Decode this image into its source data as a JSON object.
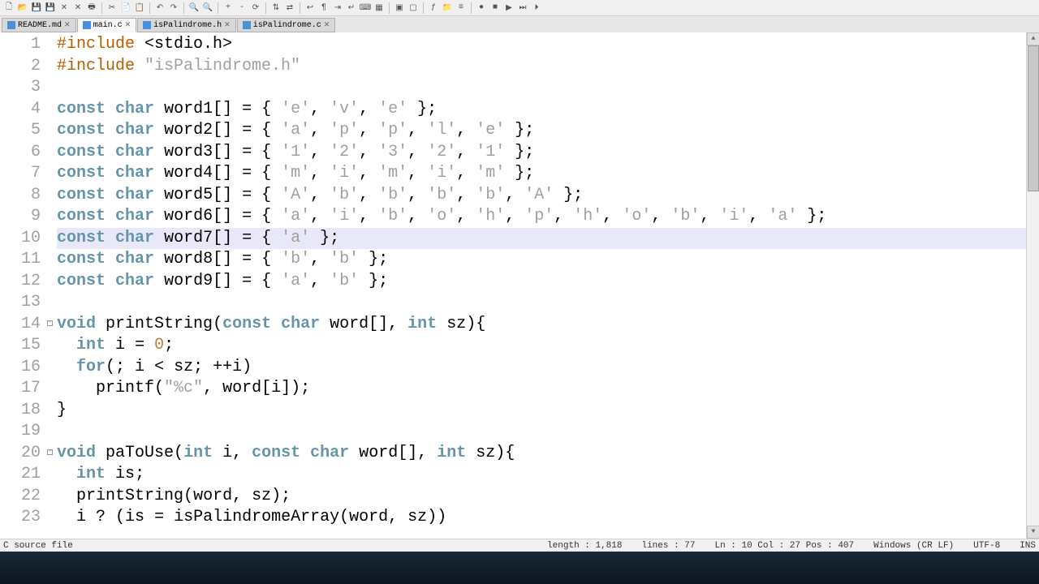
{
  "tabs": [
    {
      "label": "README.md",
      "active": false
    },
    {
      "label": "main.c",
      "active": true
    },
    {
      "label": "isPalindrome.h",
      "active": false
    },
    {
      "label": "isPalindrome.c",
      "active": false
    }
  ],
  "highlighted_line": 10,
  "code_lines": [
    {
      "n": 1,
      "tokens": [
        [
          "pp",
          "#include"
        ],
        [
          "op",
          " <"
        ],
        [
          "id",
          "stdio.h"
        ],
        [
          "op",
          ">"
        ]
      ]
    },
    {
      "n": 2,
      "tokens": [
        [
          "pp",
          "#include"
        ],
        [
          "op",
          " "
        ],
        [
          "str",
          "\"isPalindrome.h\""
        ]
      ]
    },
    {
      "n": 3,
      "tokens": []
    },
    {
      "n": 4,
      "tokens": [
        [
          "kw",
          "const"
        ],
        [
          "op",
          " "
        ],
        [
          "ty",
          "char"
        ],
        [
          "op",
          " "
        ],
        [
          "id",
          "word1"
        ],
        [
          "op",
          "[] = { "
        ],
        [
          "ch",
          "'e'"
        ],
        [
          "op",
          ", "
        ],
        [
          "ch",
          "'v'"
        ],
        [
          "op",
          ", "
        ],
        [
          "ch",
          "'e'"
        ],
        [
          "op",
          " };"
        ]
      ]
    },
    {
      "n": 5,
      "tokens": [
        [
          "kw",
          "const"
        ],
        [
          "op",
          " "
        ],
        [
          "ty",
          "char"
        ],
        [
          "op",
          " "
        ],
        [
          "id",
          "word2"
        ],
        [
          "op",
          "[] = { "
        ],
        [
          "ch",
          "'a'"
        ],
        [
          "op",
          ", "
        ],
        [
          "ch",
          "'p'"
        ],
        [
          "op",
          ", "
        ],
        [
          "ch",
          "'p'"
        ],
        [
          "op",
          ", "
        ],
        [
          "ch",
          "'l'"
        ],
        [
          "op",
          ", "
        ],
        [
          "ch",
          "'e'"
        ],
        [
          "op",
          " };"
        ]
      ]
    },
    {
      "n": 6,
      "tokens": [
        [
          "kw",
          "const"
        ],
        [
          "op",
          " "
        ],
        [
          "ty",
          "char"
        ],
        [
          "op",
          " "
        ],
        [
          "id",
          "word3"
        ],
        [
          "op",
          "[] = { "
        ],
        [
          "ch",
          "'1'"
        ],
        [
          "op",
          ", "
        ],
        [
          "ch",
          "'2'"
        ],
        [
          "op",
          ", "
        ],
        [
          "ch",
          "'3'"
        ],
        [
          "op",
          ", "
        ],
        [
          "ch",
          "'2'"
        ],
        [
          "op",
          ", "
        ],
        [
          "ch",
          "'1'"
        ],
        [
          "op",
          " };"
        ]
      ]
    },
    {
      "n": 7,
      "tokens": [
        [
          "kw",
          "const"
        ],
        [
          "op",
          " "
        ],
        [
          "ty",
          "char"
        ],
        [
          "op",
          " "
        ],
        [
          "id",
          "word4"
        ],
        [
          "op",
          "[] = { "
        ],
        [
          "ch",
          "'m'"
        ],
        [
          "op",
          ", "
        ],
        [
          "ch",
          "'i'"
        ],
        [
          "op",
          ", "
        ],
        [
          "ch",
          "'m'"
        ],
        [
          "op",
          ", "
        ],
        [
          "ch",
          "'i'"
        ],
        [
          "op",
          ", "
        ],
        [
          "ch",
          "'m'"
        ],
        [
          "op",
          " };"
        ]
      ]
    },
    {
      "n": 8,
      "tokens": [
        [
          "kw",
          "const"
        ],
        [
          "op",
          " "
        ],
        [
          "ty",
          "char"
        ],
        [
          "op",
          " "
        ],
        [
          "id",
          "word5"
        ],
        [
          "op",
          "[] = { "
        ],
        [
          "ch",
          "'A'"
        ],
        [
          "op",
          ", "
        ],
        [
          "ch",
          "'b'"
        ],
        [
          "op",
          ", "
        ],
        [
          "ch",
          "'b'"
        ],
        [
          "op",
          ", "
        ],
        [
          "ch",
          "'b'"
        ],
        [
          "op",
          ", "
        ],
        [
          "ch",
          "'b'"
        ],
        [
          "op",
          ", "
        ],
        [
          "ch",
          "'A'"
        ],
        [
          "op",
          " };"
        ]
      ]
    },
    {
      "n": 9,
      "tokens": [
        [
          "kw",
          "const"
        ],
        [
          "op",
          " "
        ],
        [
          "ty",
          "char"
        ],
        [
          "op",
          " "
        ],
        [
          "id",
          "word6"
        ],
        [
          "op",
          "[] = { "
        ],
        [
          "ch",
          "'a'"
        ],
        [
          "op",
          ", "
        ],
        [
          "ch",
          "'i'"
        ],
        [
          "op",
          ", "
        ],
        [
          "ch",
          "'b'"
        ],
        [
          "op",
          ", "
        ],
        [
          "ch",
          "'o'"
        ],
        [
          "op",
          ", "
        ],
        [
          "ch",
          "'h'"
        ],
        [
          "op",
          ", "
        ],
        [
          "ch",
          "'p'"
        ],
        [
          "op",
          ", "
        ],
        [
          "ch",
          "'h'"
        ],
        [
          "op",
          ", "
        ],
        [
          "ch",
          "'o'"
        ],
        [
          "op",
          ", "
        ],
        [
          "ch",
          "'b'"
        ],
        [
          "op",
          ", "
        ],
        [
          "ch",
          "'i'"
        ],
        [
          "op",
          ", "
        ],
        [
          "ch",
          "'a'"
        ],
        [
          "op",
          " };"
        ]
      ]
    },
    {
      "n": 10,
      "tokens": [
        [
          "kw",
          "const"
        ],
        [
          "op",
          " "
        ],
        [
          "ty",
          "char"
        ],
        [
          "op",
          " "
        ],
        [
          "id",
          "word7"
        ],
        [
          "op",
          "[] = { "
        ],
        [
          "ch",
          "'a'"
        ],
        [
          "op",
          " };"
        ]
      ]
    },
    {
      "n": 11,
      "tokens": [
        [
          "kw",
          "const"
        ],
        [
          "op",
          " "
        ],
        [
          "ty",
          "char"
        ],
        [
          "op",
          " "
        ],
        [
          "id",
          "word8"
        ],
        [
          "op",
          "[] = { "
        ],
        [
          "ch",
          "'b'"
        ],
        [
          "op",
          ", "
        ],
        [
          "ch",
          "'b'"
        ],
        [
          "op",
          " };"
        ]
      ]
    },
    {
      "n": 12,
      "tokens": [
        [
          "kw",
          "const"
        ],
        [
          "op",
          " "
        ],
        [
          "ty",
          "char"
        ],
        [
          "op",
          " "
        ],
        [
          "id",
          "word9"
        ],
        [
          "op",
          "[] = { "
        ],
        [
          "ch",
          "'a'"
        ],
        [
          "op",
          ", "
        ],
        [
          "ch",
          "'b'"
        ],
        [
          "op",
          " };"
        ]
      ]
    },
    {
      "n": 13,
      "tokens": []
    },
    {
      "n": 14,
      "tokens": [
        [
          "ty",
          "void"
        ],
        [
          "op",
          " "
        ],
        [
          "id",
          "printString"
        ],
        [
          "op",
          "("
        ],
        [
          "kw",
          "const"
        ],
        [
          "op",
          " "
        ],
        [
          "ty",
          "char"
        ],
        [
          "op",
          " "
        ],
        [
          "id",
          "word"
        ],
        [
          "op",
          "[], "
        ],
        [
          "ty",
          "int"
        ],
        [
          "op",
          " "
        ],
        [
          "id",
          "sz"
        ],
        [
          "op",
          "){"
        ]
      ]
    },
    {
      "n": 15,
      "tokens": [
        [
          "op",
          "  "
        ],
        [
          "ty",
          "int"
        ],
        [
          "op",
          " "
        ],
        [
          "id",
          "i"
        ],
        [
          "op",
          " = "
        ],
        [
          "num",
          "0"
        ],
        [
          "op",
          ";"
        ]
      ]
    },
    {
      "n": 16,
      "tokens": [
        [
          "op",
          "  "
        ],
        [
          "kw",
          "for"
        ],
        [
          "op",
          "(; "
        ],
        [
          "id",
          "i"
        ],
        [
          "op",
          " < "
        ],
        [
          "id",
          "sz"
        ],
        [
          "op",
          "; ++"
        ],
        [
          "id",
          "i"
        ],
        [
          "op",
          ")"
        ]
      ]
    },
    {
      "n": 17,
      "tokens": [
        [
          "op",
          "    "
        ],
        [
          "id",
          "printf"
        ],
        [
          "op",
          "("
        ],
        [
          "str",
          "\"%c\""
        ],
        [
          "op",
          ", "
        ],
        [
          "id",
          "word"
        ],
        [
          "op",
          "["
        ],
        [
          "id",
          "i"
        ],
        [
          "op",
          "]);"
        ]
      ]
    },
    {
      "n": 18,
      "tokens": [
        [
          "op",
          "}"
        ]
      ]
    },
    {
      "n": 19,
      "tokens": []
    },
    {
      "n": 20,
      "tokens": [
        [
          "ty",
          "void"
        ],
        [
          "op",
          " "
        ],
        [
          "id",
          "paToUse"
        ],
        [
          "op",
          "("
        ],
        [
          "ty",
          "int"
        ],
        [
          "op",
          " "
        ],
        [
          "id",
          "i"
        ],
        [
          "op",
          ", "
        ],
        [
          "kw",
          "const"
        ],
        [
          "op",
          " "
        ],
        [
          "ty",
          "char"
        ],
        [
          "op",
          " "
        ],
        [
          "id",
          "word"
        ],
        [
          "op",
          "[], "
        ],
        [
          "ty",
          "int"
        ],
        [
          "op",
          " "
        ],
        [
          "id",
          "sz"
        ],
        [
          "op",
          "){"
        ]
      ]
    },
    {
      "n": 21,
      "tokens": [
        [
          "op",
          "  "
        ],
        [
          "ty",
          "int"
        ],
        [
          "op",
          " "
        ],
        [
          "id",
          "is"
        ],
        [
          "op",
          ";"
        ]
      ]
    },
    {
      "n": 22,
      "tokens": [
        [
          "op",
          "  "
        ],
        [
          "id",
          "printString"
        ],
        [
          "op",
          "("
        ],
        [
          "id",
          "word"
        ],
        [
          "op",
          ", "
        ],
        [
          "id",
          "sz"
        ],
        [
          "op",
          ");"
        ]
      ]
    },
    {
      "n": 23,
      "tokens": [
        [
          "op",
          "  "
        ],
        [
          "id",
          "i"
        ],
        [
          "op",
          " ? ("
        ],
        [
          "id",
          "is"
        ],
        [
          "op",
          " = "
        ],
        [
          "id",
          "isPalindromeArray"
        ],
        [
          "op",
          "("
        ],
        [
          "id",
          "word"
        ],
        [
          "op",
          ", "
        ],
        [
          "id",
          "sz"
        ],
        [
          "op",
          "))"
        ]
      ]
    }
  ],
  "status": {
    "left": "C source file",
    "length": "length : 1,818",
    "lines": "lines : 77",
    "pos": "Ln : 10    Col : 27    Pos : 407",
    "eol": "Windows (CR LF)",
    "enc": "UTF-8",
    "ins": "INS"
  },
  "toolbar_icons": [
    "new",
    "open",
    "save",
    "save-all",
    "close",
    "close-all",
    "print",
    "sep",
    "cut",
    "copy",
    "paste",
    "sep",
    "undo",
    "redo",
    "sep",
    "find",
    "replace",
    "sep",
    "zoom-in",
    "zoom-out",
    "zoom-reset",
    "sep",
    "sync-v",
    "sync-h",
    "sep",
    "wrap",
    "whitespace",
    "indent",
    "eol",
    "lang",
    "doc-map",
    "sep",
    "fold-all",
    "unfold-all",
    "sep",
    "func-list",
    "folder",
    "doc-list",
    "sep",
    "record",
    "stop",
    "play",
    "play-multi",
    "play-fast"
  ]
}
